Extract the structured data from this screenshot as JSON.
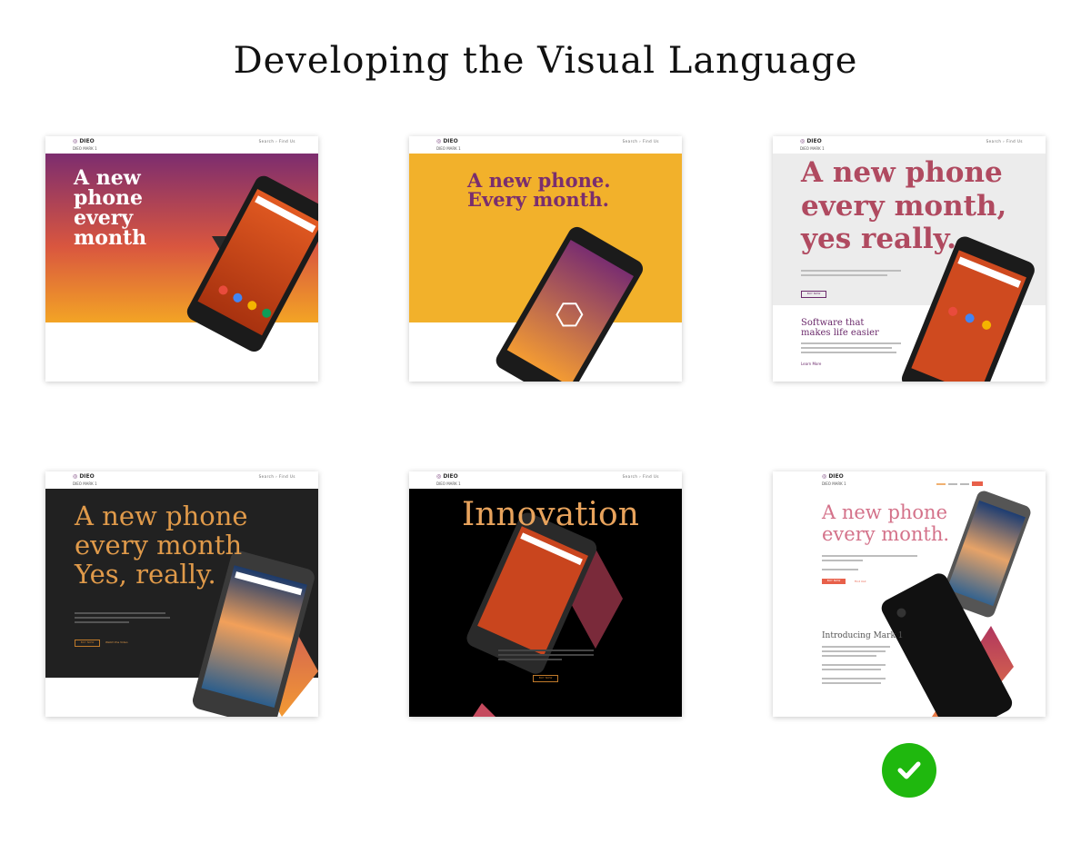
{
  "title": "Developing the Visual Language",
  "mini_nav": {
    "logo": "DIEO",
    "sub": "DIEO MARK 1",
    "links": "Search ›   Find Us"
  },
  "cards": [
    {
      "headline": "A new\nphone\nevery\nmonth",
      "bg": "#7a2f6e"
    },
    {
      "headline": "A new phone.\nEvery month.",
      "bg": "#f2b12b"
    },
    {
      "headline": "A new phone\nevery month,\nyes really.",
      "subhead": "Software that\nmakes life easier",
      "cta": "BUY NOW",
      "link": "Learn More"
    },
    {
      "headline": "A new phone\nevery month\nYes, really.",
      "cta": "BUY NOW",
      "link": "Watch the Video"
    },
    {
      "headline": "Innovation",
      "cta": "BUY NOW"
    },
    {
      "headline": "A new phone\nevery month.",
      "subhead": "Introducing Mark 1",
      "cta": "BUY NOW",
      "link": "Find Out"
    }
  ],
  "selected_icon": "check-icon",
  "colors": {
    "check": "#1fb80e",
    "purple": "#6b2a6b",
    "orange": "#f08a3a",
    "yellow": "#f2b12b"
  }
}
